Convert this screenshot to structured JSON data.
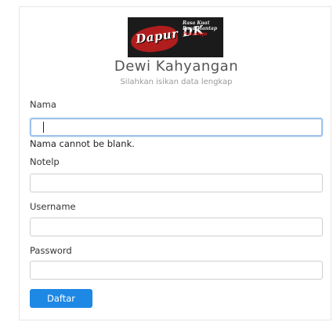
{
  "header": {
    "logo_icon": "dapur-dk-logo",
    "logo_brand": "Dapur DK",
    "logo_tagline_line1": "Rasa Kuat",
    "logo_tagline_line2": "Rasa Mantap",
    "logo_tagline_line3": "Pedasnya",
    "title": "Dewi Kahyangan",
    "subtitle": "Silahkan isikan data lengkap"
  },
  "form": {
    "nama": {
      "label": "Nama",
      "value": "",
      "error": "Nama cannot be blank."
    },
    "notelp": {
      "label": "Notelp",
      "value": ""
    },
    "username": {
      "label": "Username",
      "value": ""
    },
    "password": {
      "label": "Password",
      "value": ""
    },
    "submit_label": "Daftar"
  },
  "colors": {
    "accent": "#1e88e5",
    "focus_border": "#9ec1ea"
  }
}
